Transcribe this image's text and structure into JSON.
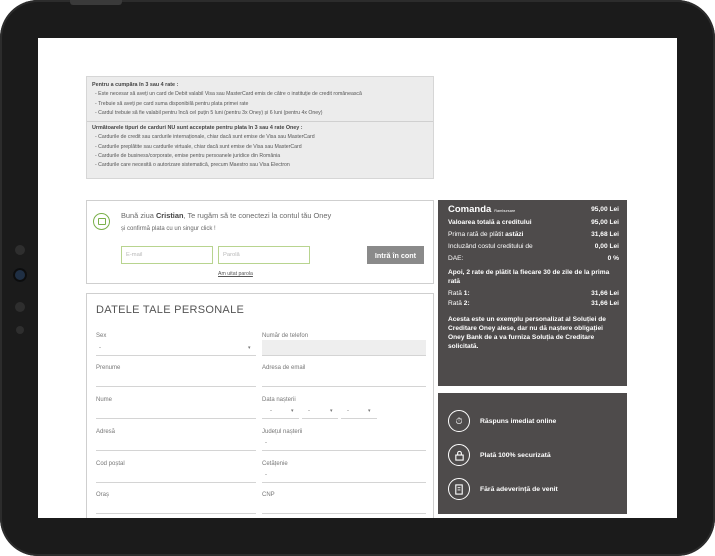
{
  "info": {
    "section1_title": "Pentru a cumpăra în 3 sau 4 rate :",
    "section1_items": [
      "Este necesar să aveți un card de Debit valabil Visa sau MasterCard emis de către o instituție de credit românească",
      "Trebuie să aveți pe card suma disponibilă pentru plata primei rate",
      "Cardul trebuie să fie valabil pentru încă cel puțin 5 luni (pentru 3x Oney) și 6 luni (pentru 4x Oney)"
    ],
    "section2_title": "Următoarele tipuri de carduri NU sunt acceptate pentru plata în 3 sau 4 rate Oney :",
    "section2_items": [
      "Cardurile de credit sau cardurile internaționale, chiar dacă sunt emise de Visa sau MasterCard",
      "Cardurile preplătite sau cardurile virtuale, chiar dacă sunt emise de Visa sau MasterCard",
      "Cardurile de business/corporate, emise pentru persoanele juridice din România",
      "Cardurile care necesită o autorizare sistematică, precum Maestro sau Visa Electron"
    ]
  },
  "login": {
    "greeting_pre": "Bună ziua ",
    "name": "Cristian",
    "greeting_post": ", Te rugăm să te conectezi la contul tău Oney",
    "subtitle": "și confirmă plata cu un singur click !",
    "email_placeholder": "E-mail",
    "password_placeholder": "Parolă",
    "button_label": "Intră în cont",
    "forgot_link": "Am uitat parola"
  },
  "form": {
    "title": "DATELE TALE PERSONALE",
    "sex_label": "Sex",
    "sex_value": "-",
    "phone_label": "Număr de telefon",
    "firstname_label": "Prenume",
    "email_label": "Adresa de email",
    "lastname_label": "Nume",
    "birthdate_label": "Data nașterii",
    "birth_day": "-",
    "birth_month": "-",
    "birth_year": "-",
    "address_label": "Adresă",
    "birth_county_label": "Județul nașterii",
    "birth_county_value": "-",
    "postal_label": "Cod poștal",
    "citizenship_label": "Cetățenie",
    "citizenship_value": "-",
    "city_label": "Oraș",
    "cnp_label": "CNP"
  },
  "order": {
    "title": "Comanda",
    "title_tag": "Rambursare",
    "total_value": "95,00 Lei",
    "credit_total_label": "Valoarea totală a creditului",
    "credit_total_value": "95,00 Lei",
    "first_rate_label": "Prima rată de plătit ",
    "first_rate_emph": "astăzi",
    "first_rate_value": "31,68 Lei",
    "cost_label": "Incluzând costul creditului de",
    "cost_value": "0,00 Lei",
    "dae_label": "DAE:",
    "dae_value": "0 %",
    "then_text": "Apoi,  2  rate de plătit la fiecare 30 de zile de la prima rată",
    "rate1_label": "Rată ",
    "rate1_num": "1",
    "rate1_value": "31,66 Lei",
    "rate2_label": "Rată ",
    "rate2_num": "2",
    "rate2_value": "31,66 Lei",
    "disclaimer": "Acesta este un exemplu personalizat al Soluției de Creditare Oney alese, dar nu dă naștere obligației Oney Bank de a va furniza Soluția de Creditare solicitată."
  },
  "features": [
    {
      "label": "Răspuns imediat online",
      "icon": "stopwatch-icon"
    },
    {
      "label": "Plată 100% securizată",
      "icon": "lock-icon"
    },
    {
      "label": "Fără adeverință de venit",
      "icon": "document-icon"
    }
  ],
  "colors": {
    "accent_green": "#7ab04a",
    "panel_dark": "#4e4b4b",
    "button_gray": "#8a8a8a"
  }
}
